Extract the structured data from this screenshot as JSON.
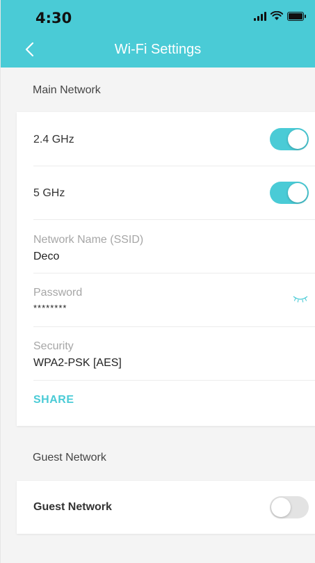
{
  "status_bar": {
    "time": "4:30"
  },
  "header": {
    "title": "Wi-Fi Settings"
  },
  "main_network": {
    "section_label": "Main Network",
    "band_24": {
      "label": "2.4 GHz",
      "enabled": true
    },
    "band_5": {
      "label": "5 GHz",
      "enabled": true
    },
    "ssid": {
      "label": "Network Name (SSID)",
      "value": "Deco"
    },
    "password": {
      "label": "Password",
      "value": "********"
    },
    "security": {
      "label": "Security",
      "value": "WPA2-PSK [AES]"
    },
    "share_label": "SHARE"
  },
  "guest_network": {
    "section_label": "Guest Network",
    "toggle_label": "Guest Network",
    "enabled": false
  },
  "colors": {
    "accent": "#4acbd6"
  }
}
